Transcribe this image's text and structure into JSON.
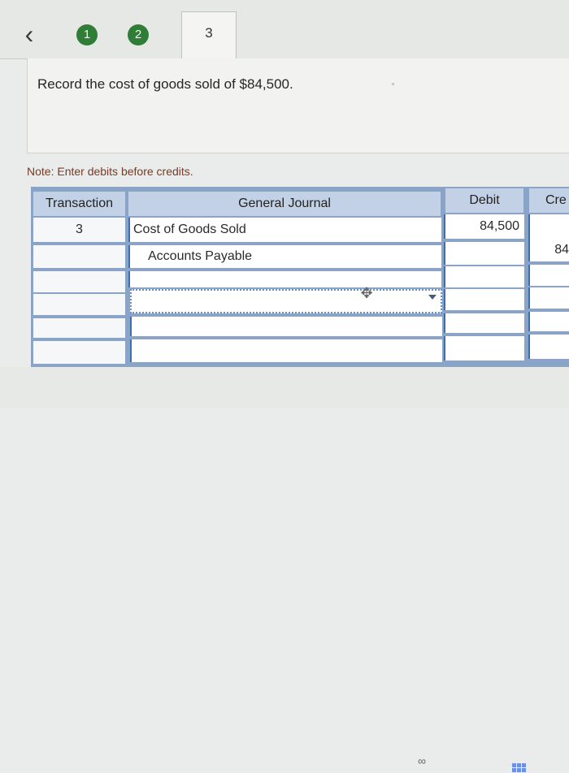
{
  "nav": {
    "back_icon": "chevron-left-icon",
    "steps": [
      {
        "label": "1",
        "state": "completed"
      },
      {
        "label": "2",
        "state": "completed"
      },
      {
        "label": "3",
        "state": "current"
      }
    ],
    "step_color": "#2f7d37"
  },
  "instruction": "Record the cost of goods sold of $84,500.",
  "note": "Note: Enter debits before credits.",
  "table": {
    "headers": {
      "transaction": "Transaction",
      "general_journal": "General Journal",
      "debit": "Debit",
      "credit": "Cre"
    },
    "rows": [
      {
        "transaction": "3",
        "account": "Cost of Goods Sold",
        "debit": "84,500",
        "credit": ""
      },
      {
        "transaction": "",
        "account": "Accounts Payable",
        "debit": "",
        "credit": "84"
      },
      {
        "transaction": "",
        "account": "",
        "debit": "",
        "credit": ""
      },
      {
        "transaction": "",
        "account": "",
        "debit": "",
        "credit": ""
      },
      {
        "transaction": "",
        "account": "",
        "debit": "",
        "credit": ""
      },
      {
        "transaction": "",
        "account": "",
        "debit": "",
        "credit": ""
      }
    ]
  },
  "colors": {
    "header_bg": "#c2d1e6",
    "grid_border": "#8aa4c7",
    "note_text": "#7a3a26"
  }
}
